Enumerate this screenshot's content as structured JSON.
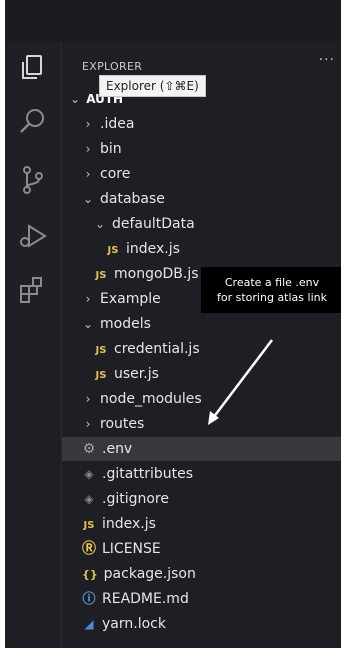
{
  "explorer": {
    "header": "EXPLORER",
    "more": "···",
    "tooltip": "Explorer (⇧⌘E)",
    "root": "AUTH"
  },
  "icons": {
    "activity": [
      "files-icon",
      "search-icon",
      "source-control-icon",
      "run-debug-icon",
      "extensions-icon"
    ],
    "chevron_right": "›",
    "chevron_down": "⌄"
  },
  "tree": [
    {
      "label": ".idea",
      "type": "folder",
      "expanded": false,
      "indent": 1
    },
    {
      "label": "bin",
      "type": "folder",
      "expanded": false,
      "indent": 1
    },
    {
      "label": "core",
      "type": "folder",
      "expanded": false,
      "indent": 1
    },
    {
      "label": "database",
      "type": "folder",
      "expanded": true,
      "indent": 1
    },
    {
      "label": "defaultData",
      "type": "folder",
      "expanded": true,
      "indent": 2
    },
    {
      "label": "index.js",
      "type": "js",
      "indent": 3
    },
    {
      "label": "mongoDB.js",
      "type": "js",
      "indent": 2
    },
    {
      "label": "Example",
      "type": "folder",
      "expanded": false,
      "indent": 1
    },
    {
      "label": "models",
      "type": "folder",
      "expanded": true,
      "indent": 1
    },
    {
      "label": "credential.js",
      "type": "js",
      "indent": 2
    },
    {
      "label": "user.js",
      "type": "js",
      "indent": 2
    },
    {
      "label": "node_modules",
      "type": "folder",
      "expanded": false,
      "indent": 1
    },
    {
      "label": "routes",
      "type": "folder",
      "expanded": false,
      "indent": 1
    },
    {
      "label": ".env",
      "type": "env",
      "indent": 1,
      "selected": true
    },
    {
      "label": ".gitattributes",
      "type": "git",
      "indent": 1
    },
    {
      "label": ".gitignore",
      "type": "git",
      "indent": 1
    },
    {
      "label": "index.js",
      "type": "js",
      "indent": 1
    },
    {
      "label": "LICENSE",
      "type": "license",
      "indent": 1
    },
    {
      "label": "package.json",
      "type": "json",
      "indent": 1
    },
    {
      "label": "README.md",
      "type": "info",
      "indent": 1
    },
    {
      "label": "yarn.lock",
      "type": "yarn",
      "indent": 1
    }
  ],
  "file_icons": {
    "js": "JS",
    "env": "⚙",
    "git": "◈",
    "license": "Ⓡ",
    "json": "{}",
    "info": "ⓘ",
    "yarn": "◢"
  },
  "annotation": {
    "line1": "Create a file .env",
    "line2": "for storing atlas link"
  },
  "colors": {
    "background": "#1e1f24",
    "selected_row": "#37383d",
    "js_icon": "#e5c34a"
  }
}
